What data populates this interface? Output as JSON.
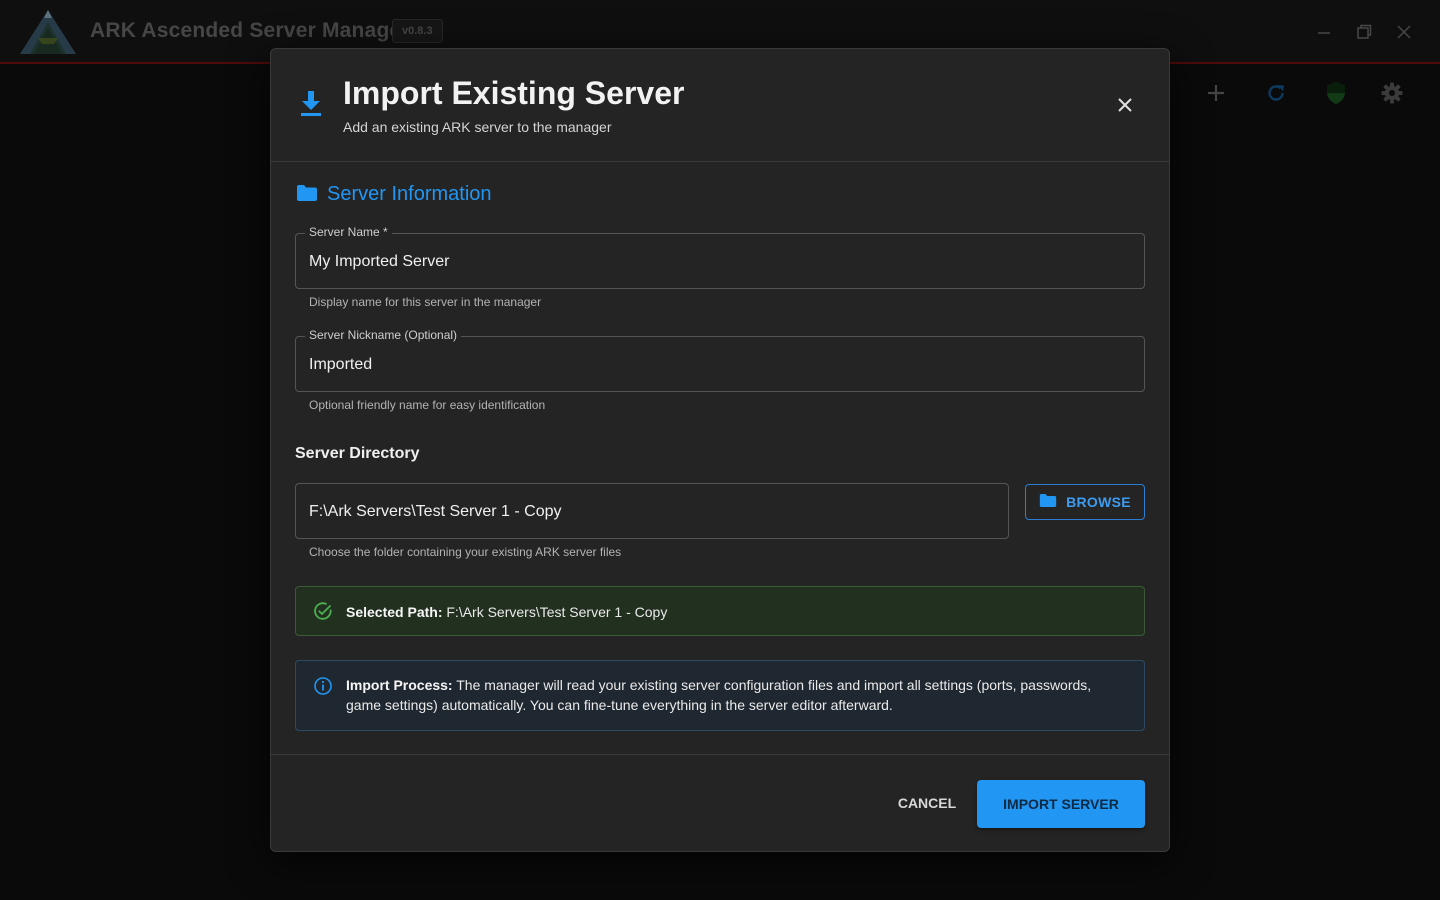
{
  "app": {
    "title": "ARK Ascended Server Manager",
    "version": "v0.8.3"
  },
  "toolbar": {
    "icons": [
      "add-icon",
      "refresh-icon",
      "shield-icon",
      "gear-icon"
    ]
  },
  "dialog": {
    "title": "Import Existing Server",
    "subtitle": "Add an existing ARK server to the manager",
    "section_title": "Server Information",
    "server_name": {
      "label": "Server Name *",
      "value": "My Imported Server",
      "helper": "Display name for this server in the manager"
    },
    "nickname": {
      "label": "Server Nickname (Optional)",
      "value": "Imported",
      "helper": "Optional friendly name for easy identification"
    },
    "directory": {
      "heading": "Server Directory",
      "value": "F:\\Ark Servers\\Test Server 1 - Copy",
      "helper": "Choose the folder containing your existing ARK server files",
      "browse_label": "BROWSE"
    },
    "selected_path": {
      "label": "Selected Path:",
      "value": "F:\\Ark Servers\\Test Server 1 - Copy"
    },
    "info": {
      "label": "Import Process:",
      "text": "The manager will read your existing server configuration files and import all settings (ports, passwords, game settings) automatically. You can fine-tune everything in the server editor afterward."
    },
    "cancel_label": "CANCEL",
    "import_label": "IMPORT SERVER"
  },
  "colors": {
    "accent": "#2196f3",
    "success": "#4caf50",
    "titlebar_border": "#7a1010"
  }
}
